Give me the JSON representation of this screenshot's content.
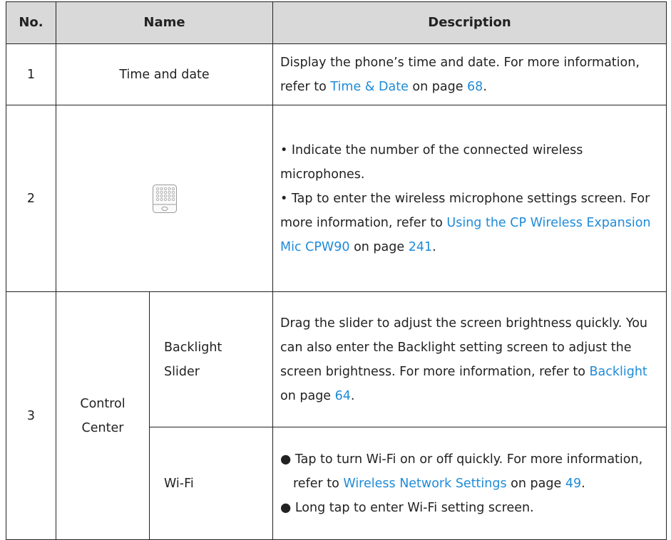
{
  "header": {
    "no": "No.",
    "name": "Name",
    "description": "Description"
  },
  "rows": [
    {
      "no": "1",
      "name": "Time and date",
      "desc": {
        "text1": "Display the phone’s time and date. For more information, refer to ",
        "link1": "Time & Date",
        "text2": " on page ",
        "page": "68",
        "text3": "."
      }
    },
    {
      "no": "2",
      "icon": "wireless-microphone-icon",
      "desc": {
        "p1": "• Indicate the number of the connected wireless microphones.",
        "p2_text1": "• Tap to enter the wireless microphone settings screen. For more information, refer to ",
        "p2_link": "Using the CP Wireless Expansion Mic CPW90",
        "p2_text2": " on page ",
        "p2_page": "241",
        "p2_text3": "."
      }
    },
    {
      "no": "3",
      "name": "Control Center",
      "sub": [
        {
          "name": "Backlight Slider",
          "desc": {
            "text1": "Drag the slider to adjust the screen brightness quickly. You can also enter the Backlight setting screen to adjust the screen brightness. For more information, refer to ",
            "link": "Backlight",
            "text2": " on page ",
            "page": "64",
            "text3": "."
          }
        },
        {
          "name": "Wi-Fi",
          "desc": {
            "b1_text1": "● Tap to turn Wi-Fi on or off quickly. For more information, refer to ",
            "b1_link": "Wireless Network Settings",
            "b1_text2": " on page ",
            "b1_page": "49",
            "b1_text3": ".",
            "b2": "● Long tap to enter Wi-Fi setting screen."
          }
        }
      ]
    }
  ]
}
